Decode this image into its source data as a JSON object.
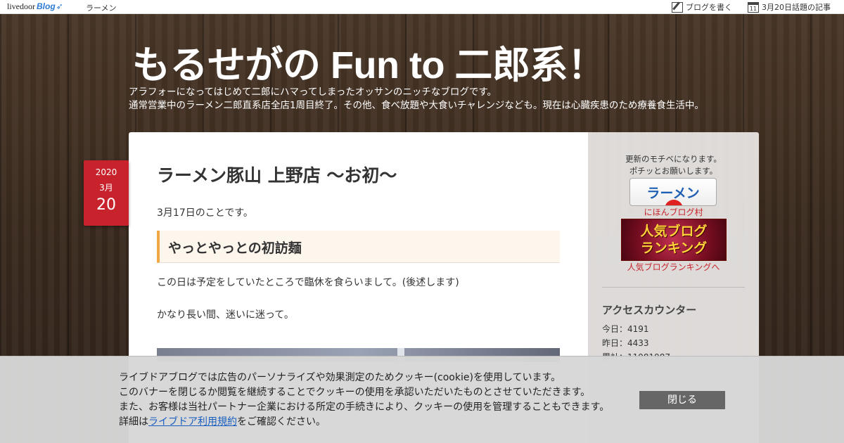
{
  "topbar": {
    "logo_brand": "livedoor",
    "logo_blog": "Blog",
    "category": "ラーメン",
    "write_label": "ブログを書く",
    "trend_label": "3月20日話題の記事",
    "calendar_day": "11"
  },
  "header": {
    "title": "もるせがの Fun to 二郎系！",
    "desc_line1": "アラフォーになってはじめて二郎にハマってしまったオッサンのニッチなブログです。",
    "desc_line2": "通常営業中のラーメン二郎直系店全店1周目終了。その他、食べ放題や大食いチャレンジなども。現在は心臓疾患のため療養食生活中。"
  },
  "date": {
    "year": "2020",
    "month": "3月",
    "day": "20"
  },
  "article": {
    "title": "ラーメン豚山 上野店 〜お初〜",
    "p1": "3月17日のことです。",
    "h3": "やっとやっとの初訪麺",
    "p2": "この日は予定をしていたところで臨休を食らいまして。(後述します)",
    "p3": "かなり長い間、迷いに迷って。"
  },
  "sidebar": {
    "note_line1": "更新のモチベになります。",
    "note_line2": "ポチッとお願いします。",
    "ramen_button": "ラーメン",
    "nihon_link": "にほんブログ村",
    "rank_banner_line1": "人気ブログ",
    "rank_banner_line2": "ランキング",
    "rank_link": "人気ブログランキングへ",
    "counter_heading": "アクセスカウンター",
    "today": "今日：4191",
    "yesterday": "昨日：4433",
    "total": "累計：11981987"
  },
  "cookie": {
    "line1": "ライブドアブログでは広告のパーソナライズや効果測定のためクッキー(cookie)を使用しています。",
    "line2": "このバナーを閉じるか閲覧を継続することでクッキーの使用を承認いただいたものとさせていただきます。",
    "line3": "また、お客様は当社パートナー企業における所定の手続きにより、クッキーの使用を管理することもできます。",
    "line4_prefix": "詳細は",
    "line4_link": "ライブドア利用規約",
    "line4_suffix": "をご確認ください。",
    "close_label": "閉じる"
  }
}
